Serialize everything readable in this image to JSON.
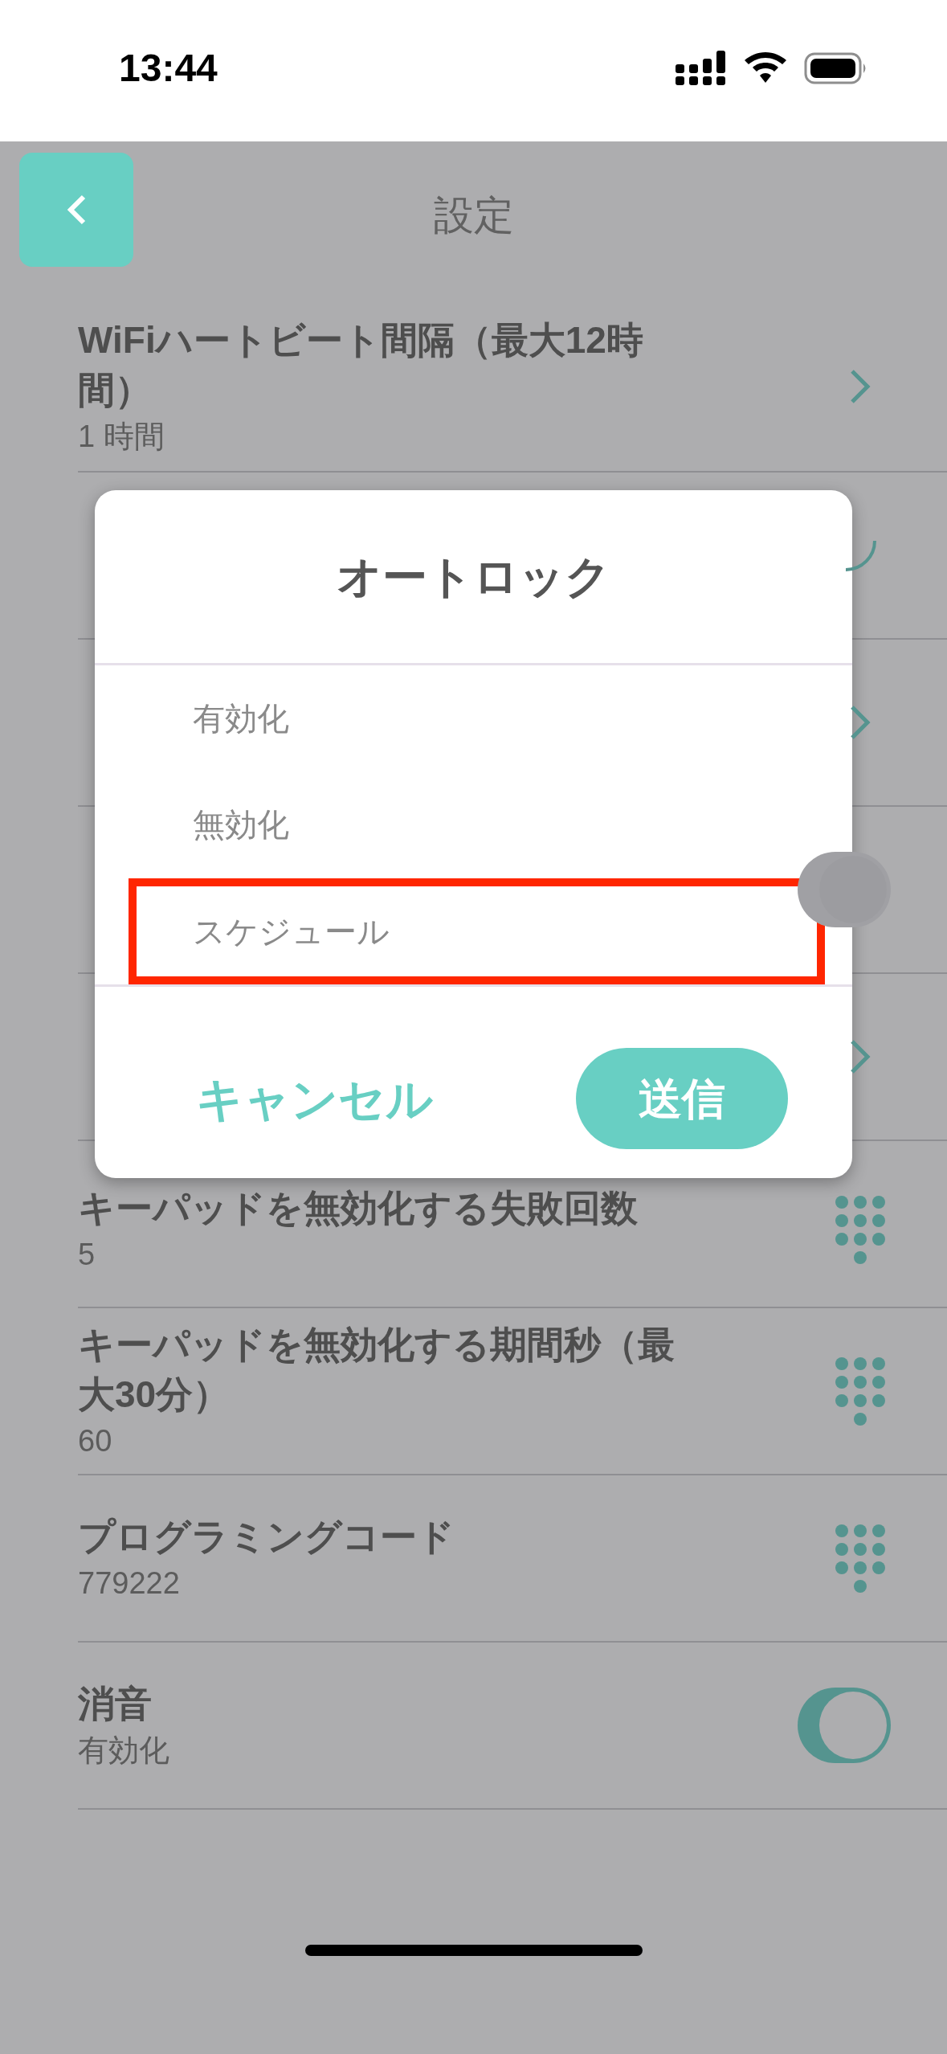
{
  "status_bar": {
    "time": "13:44"
  },
  "header": {
    "title": "設定"
  },
  "settings": [
    {
      "kind": "chevron",
      "title": "WiFiハートビート間隔（最大12時間）",
      "value": "1 時間"
    },
    {
      "kind": "spinner"
    },
    {
      "kind": "chevron"
    },
    {
      "kind": "toggle",
      "on": false
    },
    {
      "kind": "chevron"
    },
    {
      "kind": "keypad",
      "title": "キーパッドを無効化する失敗回数",
      "value": "5"
    },
    {
      "kind": "keypad",
      "title": "キーパッドを無効化する期間秒（最大30分）",
      "value": "60"
    },
    {
      "kind": "keypad",
      "title": "プログラミングコード",
      "value": "779222"
    },
    {
      "kind": "toggle",
      "on": true,
      "title": "消音",
      "value": "有効化"
    }
  ],
  "dialog": {
    "title": "オートロック",
    "options": [
      {
        "label": "有効化",
        "highlighted": false
      },
      {
        "label": "無効化",
        "highlighted": false
      },
      {
        "label": "スケジュール",
        "highlighted": true
      }
    ],
    "cancel": "キャンセル",
    "submit": "送信"
  }
}
